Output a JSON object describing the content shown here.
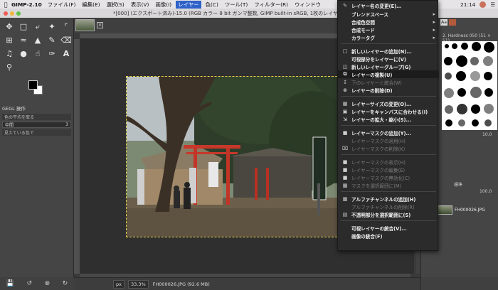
{
  "menubar": {
    "app": "GIMP-2.10",
    "items": [
      "ファイル(F)",
      "編集(E)",
      "選択(S)",
      "表示(V)",
      "画像(I)",
      "レイヤー",
      "色(C)",
      "ツール(T)",
      "フィルター(R)",
      "ウィンドウ"
    ],
    "clock": "21:14"
  },
  "window": {
    "title": "*[000] (エクスポート済み)-15.0 (RGB カラー 8 bit ガンマ整数, GIMP built-in sRGB, 1枚のレイヤー)"
  },
  "toolbox": {
    "gegl_title": "GEGL 操作",
    "gegl_placeholder": "色の平均を取る",
    "mode_label": "中間",
    "mode_value": "3",
    "gegl_hint": "見えている色で"
  },
  "statusbar": {
    "unit": "px",
    "zoom": "33.3%",
    "file": "FH000026.JPG (92.6 MB)"
  },
  "dock": {
    "brush_info": "2. Hardness 050 (51 × 51)",
    "spacing": "10.0",
    "mode": "標準",
    "opacity": "100.0",
    "layer_name": "FH000026.JPG"
  },
  "context_menu": {
    "items": [
      {
        "label": "レイヤー名の変更(E)...",
        "icon": "edit-icon",
        "disabled": false,
        "submenu": false
      },
      {
        "label": "ブレンドスペース",
        "icon": "",
        "disabled": false,
        "submenu": true
      },
      {
        "label": "合成色空間",
        "icon": "",
        "disabled": false,
        "submenu": true
      },
      {
        "label": "合成モード",
        "icon": "",
        "disabled": false,
        "submenu": true
      },
      {
        "label": "カラータグ",
        "icon": "",
        "disabled": false,
        "submenu": true
      },
      {
        "label": "新しいレイヤーの追加(N)...",
        "icon": "new-layer-icon",
        "disabled": false,
        "submenu": false
      },
      {
        "label": "可視部分をレイヤーに(V)",
        "icon": "",
        "disabled": false,
        "submenu": false
      },
      {
        "label": "新しいレイヤーグループ(G)",
        "icon": "folder-icon",
        "disabled": false,
        "submenu": false
      },
      {
        "label": "レイヤーの複製(U)",
        "icon": "duplicate-icon",
        "disabled": false,
        "submenu": false,
        "highlight": true
      },
      {
        "label": "下のレイヤーと統合(W)",
        "icon": "merge-down-icon",
        "disabled": true,
        "submenu": false
      },
      {
        "label": "レイヤーの削除(D)",
        "icon": "delete-icon",
        "disabled": false,
        "submenu": false
      },
      {
        "label": "レイヤーサイズの変更(O)...",
        "icon": "resize-icon",
        "disabled": false,
        "submenu": false
      },
      {
        "label": "レイヤーをキャンバスに合わせる(I)",
        "icon": "fit-icon",
        "disabled": false,
        "submenu": false
      },
      {
        "label": "レイヤーの拡大・縮小(S)...",
        "icon": "scale-icon",
        "disabled": false,
        "submenu": false
      },
      {
        "label": "レイヤーマスクの追加(Y)...",
        "icon": "mask-add-icon",
        "disabled": false,
        "submenu": false
      },
      {
        "label": "レイヤーマスクの適用(H)",
        "icon": "",
        "disabled": true,
        "submenu": false
      },
      {
        "label": "レイヤーマスクの削除(K)",
        "icon": "mask-delete-icon",
        "disabled": true,
        "submenu": false
      },
      {
        "label": "レイヤーマスクの表示(H)",
        "icon": "checkbox-icon",
        "disabled": true,
        "submenu": false
      },
      {
        "label": "レイヤーマスクの編集(E)",
        "icon": "checkbox-icon",
        "disabled": true,
        "submenu": false
      },
      {
        "label": "レイヤーマスクの無効化(C)",
        "icon": "checkbox-icon",
        "disabled": true,
        "submenu": false
      },
      {
        "label": "マスクを選択範囲に(M)",
        "icon": "mask-select-icon",
        "disabled": true,
        "submenu": false
      },
      {
        "label": "アルファチャンネルの追加(H)",
        "icon": "alpha-icon",
        "disabled": false,
        "submenu": false
      },
      {
        "label": "アルファチャンネルの削除(R)",
        "icon": "",
        "disabled": true,
        "submenu": false
      },
      {
        "label": "不透明部分を選択範囲に(S)",
        "icon": "alpha-select-icon",
        "disabled": false,
        "submenu": false
      },
      {
        "label": "可視レイヤーの統合(V)...",
        "icon": "",
        "disabled": false,
        "submenu": false
      },
      {
        "label": "画像の統合(F)",
        "icon": "",
        "disabled": false,
        "submenu": false
      }
    ]
  }
}
